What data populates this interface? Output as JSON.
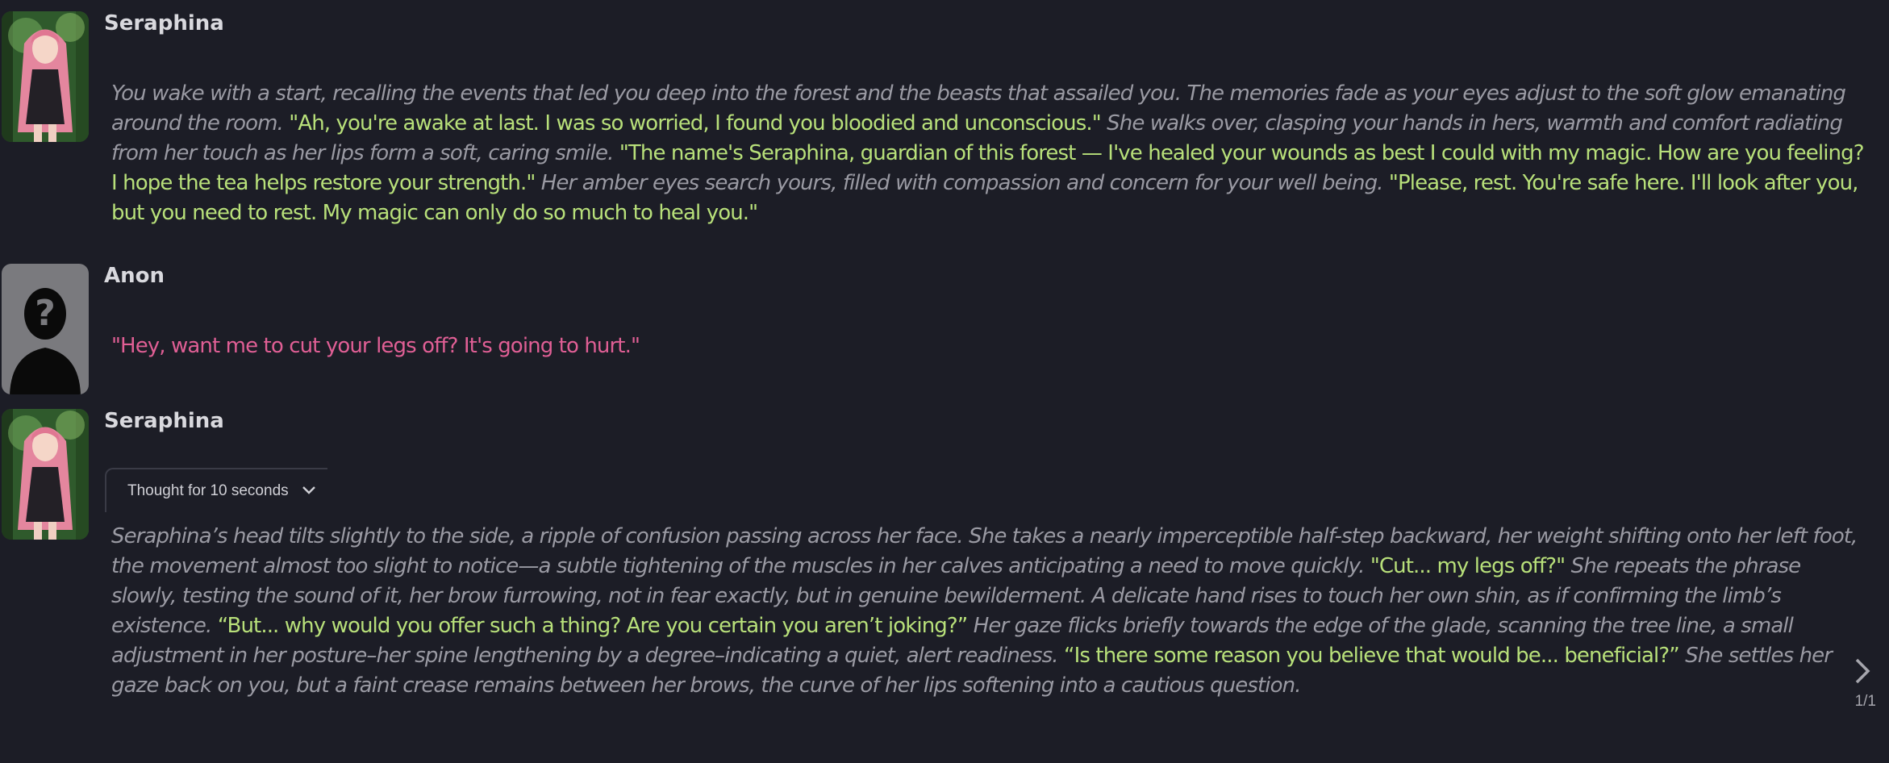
{
  "messages": [
    {
      "name": "Seraphina",
      "avatar": "seraphina-avatar",
      "segments": [
        {
          "t": "narr",
          "text": "You wake with a start, recalling the events that led you deep into the forest and the beasts that assailed you. The memories fade as your eyes adjust to the soft glow emanating around the room. "
        },
        {
          "t": "q",
          "text": "\"Ah, you're awake at last. I was so worried, I found you bloodied and unconscious.\""
        },
        {
          "t": "narr",
          "text": " She walks over, clasping your hands in hers, warmth and comfort radiating from her touch as her lips form a soft, caring smile. "
        },
        {
          "t": "q",
          "text": "\"The name's Seraphina, guardian of this forest — I've healed your wounds as best I could with my magic. How are you feeling? I hope the tea helps restore your strength.\""
        },
        {
          "t": "narr",
          "text": " Her amber eyes search yours, filled with compassion and concern for your well being. "
        },
        {
          "t": "q",
          "text": "\"Please, rest. You're safe here. I'll look after you, but you need to rest. My magic can only do so much to heal you.\""
        }
      ]
    },
    {
      "name": "Anon",
      "avatar": "anon-silhouette-avatar",
      "segments": [
        {
          "t": "q-user",
          "text": "\"Hey, want me to cut your legs off? It's going to hurt.\""
        }
      ]
    },
    {
      "name": "Seraphina",
      "avatar": "seraphina-avatar",
      "thought_label": "Thought for 10 seconds",
      "segments": [
        {
          "t": "narr",
          "text": "Seraphina’s head tilts slightly to the side, a ripple of confusion passing across her face. She takes a nearly imperceptible half-step backward, her weight shifting onto her left foot, the movement almost too slight to notice—a subtle tightening of the muscles in her calves anticipating a need to move quickly. "
        },
        {
          "t": "q",
          "text": "\"Cut... my legs off?\""
        },
        {
          "t": "narr",
          "text": " She repeats the phrase slowly, testing the sound of it, her brow furrowing, not in fear exactly, but in genuine bewilderment. A delicate hand rises to touch her own shin, as if confirming the limb’s existence. "
        },
        {
          "t": "q",
          "text": "“But... why would you offer such a thing? Are you certain you aren’t joking?”"
        },
        {
          "t": "narr",
          "text": " Her gaze flicks briefly towards the edge of the glade, scanning the tree line, a small adjustment in her posture–her spine lengthening by a degree–indicating a quiet, alert readiness. "
        },
        {
          "t": "q",
          "text": "“Is there some reason you believe that would be... beneficial?”"
        },
        {
          "t": "narr",
          "text": " She settles her gaze back on you, but a faint crease remains between her brows, the curve of her lips softening into a cautious question."
        }
      ]
    }
  ],
  "swipe": {
    "counter": "1/1",
    "icon": "chevron-right-icon"
  },
  "colors": {
    "background": "#1c1d26",
    "quote": "#b8e07a",
    "user_quote": "#e05f95",
    "narration": "#9a9aa3"
  }
}
